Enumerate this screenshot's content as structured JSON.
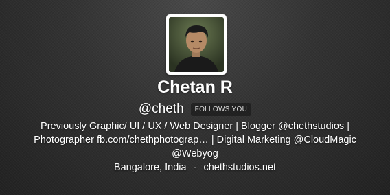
{
  "profile": {
    "name": "Chetan R",
    "handle": "@cheth",
    "follows_you": "FOLLOWS YOU",
    "bio_line1": "Previously Graphic/ UI / UX / Web Designer | Blogger @chethstudios |",
    "bio_line2": "Photographer fb.com/chethphotograp… | Digital Marketing @CloudMagic",
    "bio_line3": "@Webyog",
    "location": "Bangalore, India",
    "separator": "·",
    "website": "chethstudios.net",
    "avatar_icon": "user-photo-avatar"
  },
  "colors": {
    "background": "#333333",
    "text": "#ffffff",
    "badge_bg": "rgba(0,0,0,0.35)"
  }
}
